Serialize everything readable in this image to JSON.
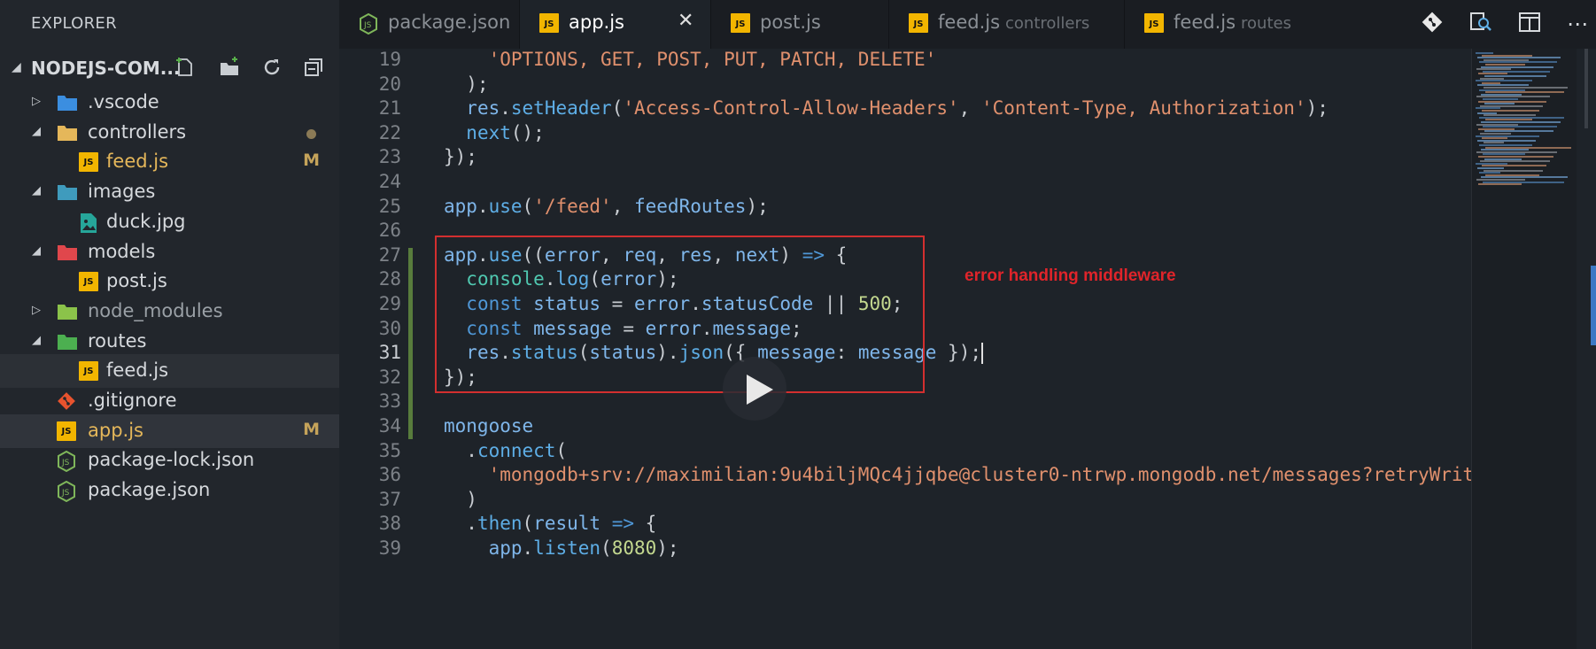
{
  "sidebar": {
    "title": "EXPLORER",
    "project": "NODEJS-COM...",
    "actions": [
      "new-file-icon",
      "new-folder-icon",
      "refresh-icon",
      "collapse-all-icon"
    ],
    "tree": [
      {
        "label": ".vscode",
        "type": "folder",
        "color": "#3b8ee0",
        "expanded": false
      },
      {
        "label": "controllers",
        "type": "folder",
        "color": "#e5b75a",
        "expanded": true,
        "modified_dot": true
      },
      {
        "label": "feed.js",
        "type": "js",
        "badge": "M",
        "label_color": "#e5b75a"
      },
      {
        "label": "images",
        "type": "folder",
        "color": "#3f9bbd",
        "expanded": true
      },
      {
        "label": "duck.jpg",
        "type": "image"
      },
      {
        "label": "models",
        "type": "folder",
        "color": "#e0474c",
        "expanded": true
      },
      {
        "label": "post.js",
        "type": "js"
      },
      {
        "label": "node_modules",
        "type": "folder",
        "color": "#8bc34a",
        "expanded": false,
        "label_color": "#9aa0a6"
      },
      {
        "label": "routes",
        "type": "folder",
        "color": "#4caf50",
        "expanded": true
      },
      {
        "label": "feed.js",
        "type": "js"
      },
      {
        "label": ".gitignore",
        "type": "git"
      },
      {
        "label": "app.js",
        "type": "js",
        "badge": "M",
        "label_color": "#e5b75a"
      },
      {
        "label": "package-lock.json",
        "type": "node"
      },
      {
        "label": "package.json",
        "type": "node"
      }
    ]
  },
  "tabs": [
    {
      "label": "package.json",
      "desc": "",
      "icon": "node"
    },
    {
      "label": "app.js",
      "desc": "",
      "icon": "js",
      "active": true
    },
    {
      "label": "post.js",
      "desc": "",
      "icon": "js"
    },
    {
      "label": "feed.js",
      "desc": "controllers",
      "icon": "js"
    },
    {
      "label": "feed.js",
      "desc": "routes",
      "icon": "js"
    }
  ],
  "toolbar": [
    "git-compare-icon",
    "open-preview-icon",
    "split-editor-icon",
    "more-icon"
  ],
  "editor": {
    "current_line": 31,
    "annotation": "error handling middleware",
    "lines": [
      {
        "n": "19",
        "tokens": [
          [
            "    ",
            "p"
          ],
          [
            "'OPTIONS, GET, POST, PUT, PATCH, DELETE'",
            "s"
          ]
        ]
      },
      {
        "n": "20",
        "tokens": [
          [
            "  );",
            "p"
          ]
        ]
      },
      {
        "n": "21",
        "tokens": [
          [
            "  ",
            "p"
          ],
          [
            "res",
            "v"
          ],
          [
            ".",
            "p"
          ],
          [
            "setHeader",
            "f"
          ],
          [
            "(",
            "p"
          ],
          [
            "'Access-Control-Allow-Headers'",
            "s"
          ],
          [
            ", ",
            "p"
          ],
          [
            "'Content-Type, Authorization'",
            "s"
          ],
          [
            ");",
            "p"
          ]
        ]
      },
      {
        "n": "22",
        "tokens": [
          [
            "  ",
            "p"
          ],
          [
            "next",
            "f"
          ],
          [
            "();",
            "p"
          ]
        ]
      },
      {
        "n": "23",
        "tokens": [
          [
            "});",
            "p"
          ]
        ]
      },
      {
        "n": "24",
        "tokens": []
      },
      {
        "n": "25",
        "tokens": [
          [
            "app",
            "v"
          ],
          [
            ".",
            "p"
          ],
          [
            "use",
            "f"
          ],
          [
            "(",
            "p"
          ],
          [
            "'/feed'",
            "s"
          ],
          [
            ", ",
            "p"
          ],
          [
            "feedRoutes",
            "v"
          ],
          [
            ");",
            "p"
          ]
        ]
      },
      {
        "n": "26",
        "tokens": []
      },
      {
        "n": "27",
        "tokens": [
          [
            "app",
            "v"
          ],
          [
            ".",
            "p"
          ],
          [
            "use",
            "f"
          ],
          [
            "((",
            "p"
          ],
          [
            "error",
            "v"
          ],
          [
            ", ",
            "p"
          ],
          [
            "req",
            "v"
          ],
          [
            ", ",
            "p"
          ],
          [
            "res",
            "v"
          ],
          [
            ", ",
            "p"
          ],
          [
            "next",
            "v"
          ],
          [
            ") ",
            "p"
          ],
          [
            "=>",
            "k"
          ],
          [
            " {",
            "p"
          ]
        ]
      },
      {
        "n": "28",
        "tokens": [
          [
            "  ",
            "p"
          ],
          [
            "console",
            "t"
          ],
          [
            ".",
            "p"
          ],
          [
            "log",
            "f"
          ],
          [
            "(",
            "p"
          ],
          [
            "error",
            "v"
          ],
          [
            ");",
            "p"
          ]
        ]
      },
      {
        "n": "29",
        "tokens": [
          [
            "  ",
            "p"
          ],
          [
            "const",
            "k"
          ],
          [
            " ",
            "p"
          ],
          [
            "status",
            "v"
          ],
          [
            " = ",
            "p"
          ],
          [
            "error",
            "v"
          ],
          [
            ".",
            "p"
          ],
          [
            "statusCode",
            "v"
          ],
          [
            " || ",
            "p"
          ],
          [
            "500",
            "n"
          ],
          [
            ";",
            "p"
          ]
        ]
      },
      {
        "n": "30",
        "tokens": [
          [
            "  ",
            "p"
          ],
          [
            "const",
            "k"
          ],
          [
            " ",
            "p"
          ],
          [
            "message",
            "v"
          ],
          [
            " = ",
            "p"
          ],
          [
            "error",
            "v"
          ],
          [
            ".",
            "p"
          ],
          [
            "message",
            "v"
          ],
          [
            ";",
            "p"
          ]
        ]
      },
      {
        "n": "31",
        "tokens": [
          [
            "  ",
            "p"
          ],
          [
            "res",
            "v"
          ],
          [
            ".",
            "p"
          ],
          [
            "status",
            "f"
          ],
          [
            "(",
            "p"
          ],
          [
            "status",
            "v"
          ],
          [
            ").",
            "p"
          ],
          [
            "json",
            "f"
          ],
          [
            "({ ",
            "p"
          ],
          [
            "message",
            "v"
          ],
          [
            ": ",
            "p"
          ],
          [
            "message",
            "v"
          ],
          [
            " });",
            "p"
          ]
        ]
      },
      {
        "n": "32",
        "tokens": [
          [
            "});",
            "p"
          ]
        ]
      },
      {
        "n": "33",
        "tokens": []
      },
      {
        "n": "34",
        "tokens": [
          [
            "mongoose",
            "v"
          ]
        ]
      },
      {
        "n": "35",
        "tokens": [
          [
            "  .",
            "p"
          ],
          [
            "connect",
            "f"
          ],
          [
            "(",
            "p"
          ]
        ]
      },
      {
        "n": "36",
        "tokens": [
          [
            "    ",
            "p"
          ],
          [
            "'mongodb+srv://maximilian:9u4biljMQc4jjqbe@cluster0-ntrwp.mongodb.net/messages?retryWrit",
            "s"
          ]
        ]
      },
      {
        "n": "37",
        "tokens": [
          [
            "  )",
            "p"
          ]
        ]
      },
      {
        "n": "38",
        "tokens": [
          [
            "  .",
            "p"
          ],
          [
            "then",
            "f"
          ],
          [
            "(",
            "p"
          ],
          [
            "result",
            "v"
          ],
          [
            " ",
            "p"
          ],
          [
            "=>",
            "k"
          ],
          [
            " {",
            "p"
          ]
        ]
      },
      {
        "n": "39",
        "tokens": [
          [
            "    ",
            "p"
          ],
          [
            "app",
            "v"
          ],
          [
            ".",
            "p"
          ],
          [
            "listen",
            "f"
          ],
          [
            "(",
            "p"
          ],
          [
            "8080",
            "n"
          ],
          [
            ");",
            "p"
          ]
        ]
      }
    ]
  }
}
